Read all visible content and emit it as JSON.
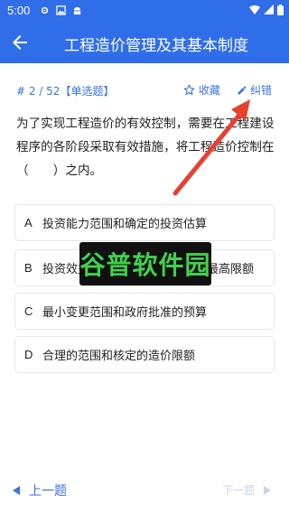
{
  "status_bar": {
    "time": "5:00"
  },
  "app_bar": {
    "title": "工程造价管理及其基本制度"
  },
  "question_meta": {
    "index": "# 2 / 52",
    "type": "【单选题】"
  },
  "actions": {
    "favorite_label": "收藏",
    "correct_label": "纠错"
  },
  "question": {
    "text": "为了实现工程造价的有效控制，需要在工程建设程序的各阶段采取有效措施，将工程造价控制在（　　）之内。"
  },
  "options": [
    {
      "letter": "A",
      "text": "投资能力范围和确定的投资估算"
    },
    {
      "letter": "B",
      "text": "投资效益范围和批准的工程造价最高限额"
    },
    {
      "letter": "C",
      "text": "最小变更范围和政府批准的预算"
    },
    {
      "letter": "D",
      "text": "合理的范围和核定的造价限额"
    }
  ],
  "watermark": {
    "text": "谷普软件园"
  },
  "navigation": {
    "prev_label": "上一题",
    "next_label": "下一题"
  },
  "colors": {
    "primary": "#2f6ee8",
    "accent_text": "#3a72e6",
    "arrow": "#e8402f",
    "disabled": "#c8d4ef"
  }
}
